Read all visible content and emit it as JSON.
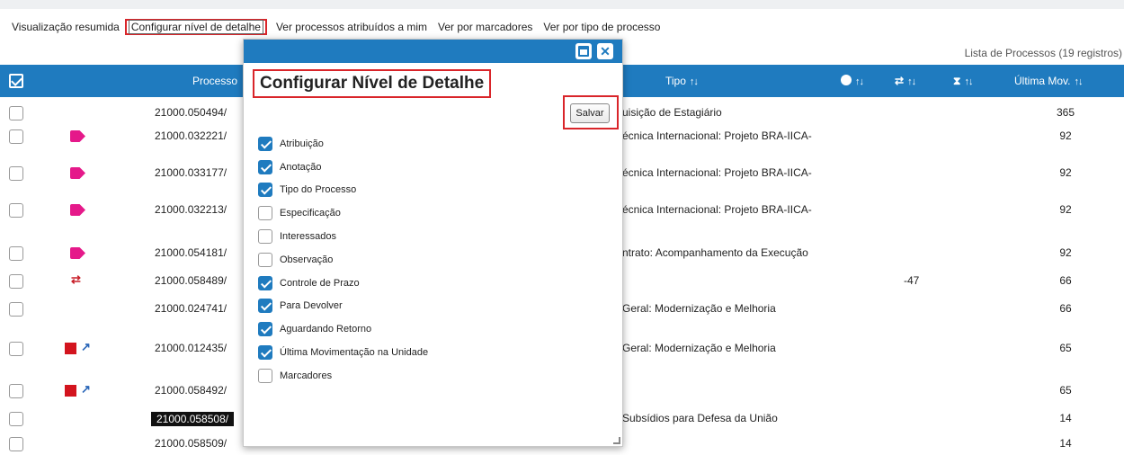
{
  "toolbar": {
    "links": [
      {
        "label": "Visualização resumida"
      },
      {
        "label": "Configurar nível de detalhe",
        "active": true
      },
      {
        "label": "Ver processos atribuídos a mim"
      },
      {
        "label": "Ver por marcadores"
      },
      {
        "label": "Ver por tipo de processo"
      }
    ]
  },
  "list_caption": "Lista de Processos (19 registros)",
  "table": {
    "headers": {
      "processo": "Processo",
      "tipo": "Tipo",
      "ultima_mov": "Última Mov."
    },
    "sort_glyph": "↑↓",
    "rows": [
      {
        "processo": "21000.050494/",
        "tipo": "uisição de Estagiário",
        "ultima_mov": "365",
        "icon": ""
      },
      {
        "processo": "21000.032221/",
        "tipo": "écnica Internacional: Projeto BRA-IICA-",
        "ultima_mov": "92",
        "icon": "tag"
      },
      {
        "processo": "21000.033177/",
        "tipo": "écnica Internacional: Projeto BRA-IICA-",
        "ultima_mov": "92",
        "icon": "tag"
      },
      {
        "processo": "21000.032213/",
        "tipo": "écnica Internacional: Projeto BRA-IICA-",
        "ultima_mov": "92",
        "icon": "tag"
      },
      {
        "processo": "21000.054181/",
        "tipo": "ntrato: Acompanhamento da Execução",
        "ultima_mov": "92",
        "icon": "tag"
      },
      {
        "processo": "21000.058489/",
        "tipo": "",
        "ultima_mov": "66",
        "prazo": "-47",
        "icon": "swap"
      },
      {
        "processo": "21000.024741/",
        "tipo": "Geral: Modernização e Melhoria",
        "ultima_mov": "66",
        "icon": ""
      },
      {
        "processo": "21000.012435/",
        "tipo": "Geral: Modernização e Melhoria",
        "ultima_mov": "65",
        "icon": "red-return"
      },
      {
        "processo": "21000.058492/",
        "tipo": "",
        "ultima_mov": "65",
        "icon": "red-return"
      },
      {
        "processo": "21000.058508/",
        "tipo": "Subsídios para Defesa da União",
        "ultima_mov": "14",
        "icon": "",
        "highlight": true
      },
      {
        "processo": "21000.058509/",
        "tipo": "",
        "ultima_mov": "14",
        "icon": ""
      }
    ]
  },
  "modal": {
    "title": "Configurar Nível de Detalhe",
    "save_label": "Salvar",
    "options": [
      {
        "label": "Atribuição",
        "checked": true
      },
      {
        "label": "Anotação",
        "checked": true
      },
      {
        "label": "Tipo do Processo",
        "checked": true
      },
      {
        "label": "Especificação",
        "checked": false
      },
      {
        "label": "Interessados",
        "checked": false
      },
      {
        "label": "Observação",
        "checked": false
      },
      {
        "label": "Controle de Prazo",
        "checked": true
      },
      {
        "label": "Para Devolver",
        "checked": true
      },
      {
        "label": "Aguardando Retorno",
        "checked": true
      },
      {
        "label": "Última Movimentação na Unidade",
        "checked": true
      },
      {
        "label": "Marcadores",
        "checked": false
      }
    ]
  },
  "colors": {
    "header_blue": "#1f7bbf",
    "highlight_red": "#d9252a",
    "tag_pink": "#e5198a"
  }
}
